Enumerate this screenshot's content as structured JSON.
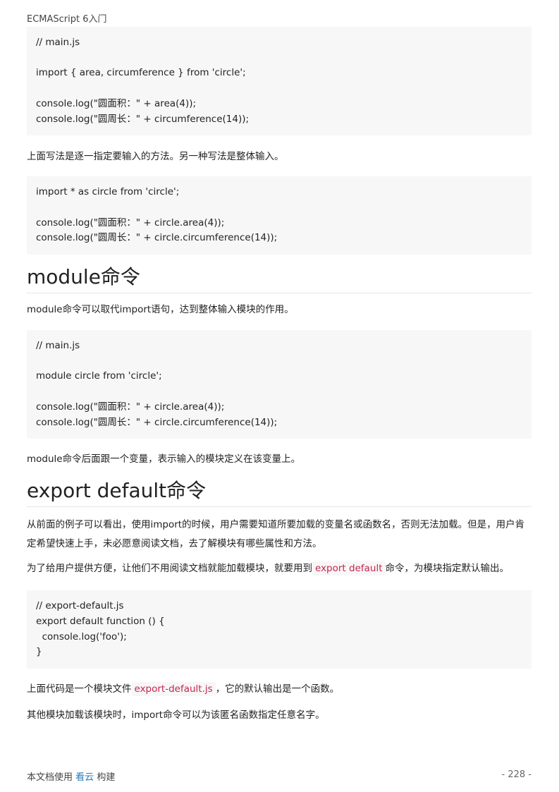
{
  "header": {
    "title": "ECMAScript 6入门"
  },
  "content": {
    "code1": "// main.js\n\nimport { area, circumference } from 'circle';\n\nconsole.log(\"圆面积：\" + area(4));\nconsole.log(\"圆周长：\" + circumference(14));",
    "para1": "上面写法是逐一指定要输入的方法。另一种写法是整体输入。",
    "code2": "import * as circle from 'circle';\n\nconsole.log(\"圆面积：\" + circle.area(4));\nconsole.log(\"圆周长：\" + circle.circumference(14));",
    "heading1": "module命令",
    "para2": "module命令可以取代import语句，达到整体输入模块的作用。",
    "code3": "// main.js\n\nmodule circle from 'circle';\n\nconsole.log(\"圆面积：\" + circle.area(4));\nconsole.log(\"圆周长：\" + circle.circumference(14));",
    "para3": "module命令后面跟一个变量，表示输入的模块定义在该变量上。",
    "heading2": "export default命令",
    "para4": "从前面的例子可以看出，使用import的时候，用户需要知道所要加载的变量名或函数名，否则无法加载。但是，用户肯定希望快速上手，未必愿意阅读文档，去了解模块有哪些属性和方法。",
    "para5_before": "为了给用户提供方便，让他们不用阅读文档就能加载模块，就要用到",
    "para5_code": "export default",
    "para5_after": "命令，为模块指定默认输出。",
    "code4": "// export-default.js\nexport default function () {\n  console.log('foo');\n}",
    "para6_before": "上面代码是一个模块文件",
    "para6_code": "export-default.js",
    "para6_after": "，它的默认输出是一个函数。",
    "para7": "其他模块加载该模块时，import命令可以为该匿名函数指定任意名字。"
  },
  "footer": {
    "prefix": "本文档使用",
    "brand": "看云",
    "suffix": "构建",
    "page_number": "- 228 -"
  }
}
